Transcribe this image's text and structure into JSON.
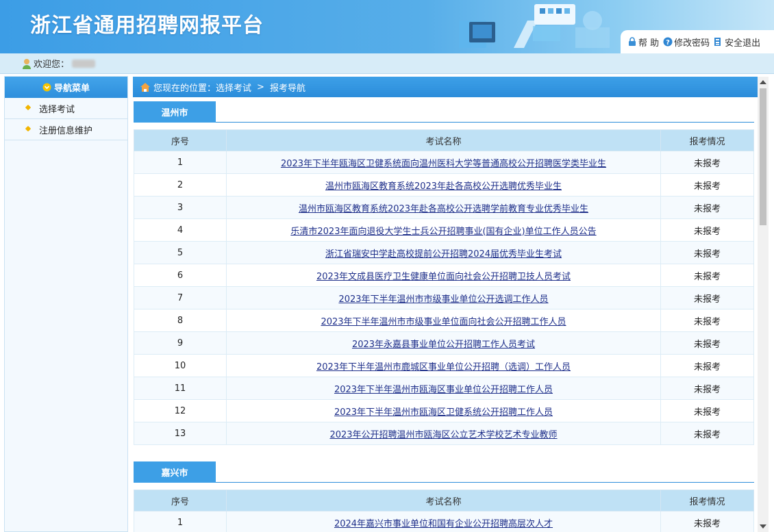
{
  "header": {
    "title": "浙江省通用招聘网报平台",
    "tools": [
      {
        "label": "帮 助",
        "icon": "lock-icon"
      },
      {
        "label": "修改密码",
        "icon": "question-icon"
      },
      {
        "label": "安全退出",
        "icon": "exit-icon"
      }
    ]
  },
  "welcome": {
    "label": "欢迎您："
  },
  "sidebar": {
    "heading": "导航菜单",
    "items": [
      {
        "label": "选择考试"
      },
      {
        "label": "注册信息维护"
      }
    ]
  },
  "breadcrumb": {
    "prefix": "您现在的位置：",
    "level1": "选择考试",
    "separator": ">",
    "level2": "报考导航"
  },
  "sections": [
    {
      "city": "温州市",
      "headers": {
        "no": "序号",
        "name": "考试名称",
        "status": "报考情况"
      },
      "rows": [
        {
          "no": "1",
          "name": "2023年下半年瓯海区卫健系统面向温州医科大学等普通高校公开招聘医学类毕业生",
          "status": "未报考"
        },
        {
          "no": "2",
          "name": "温州市瓯海区教育系统2023年赴各高校公开选聘优秀毕业生",
          "status": "未报考"
        },
        {
          "no": "3",
          "name": "温州市瓯海区教育系统2023年赴各高校公开选聘学前教育专业优秀毕业生",
          "status": "未报考"
        },
        {
          "no": "4",
          "name": "乐清市2023年面向退役大学生士兵公开招聘事业(国有企业)单位工作人员公告",
          "status": "未报考"
        },
        {
          "no": "5",
          "name": "浙江省瑞安中学赴高校提前公开招聘2024届优秀毕业生考试",
          "status": "未报考"
        },
        {
          "no": "6",
          "name": "2023年文成县医疗卫生健康单位面向社会公开招聘卫技人员考试",
          "status": "未报考"
        },
        {
          "no": "7",
          "name": "2023年下半年温州市市级事业单位公开选调工作人员",
          "status": "未报考"
        },
        {
          "no": "8",
          "name": "2023年下半年温州市市级事业单位面向社会公开招聘工作人员",
          "status": "未报考"
        },
        {
          "no": "9",
          "name": "2023年永嘉县事业单位公开招聘工作人员考试",
          "status": "未报考"
        },
        {
          "no": "10",
          "name": "2023年下半年温州市鹿城区事业单位公开招聘（选调）工作人员",
          "status": "未报考"
        },
        {
          "no": "11",
          "name": "2023年下半年温州市瓯海区事业单位公开招聘工作人员",
          "status": "未报考"
        },
        {
          "no": "12",
          "name": "2023年下半年温州市瓯海区卫健系统公开招聘工作人员",
          "status": "未报考"
        },
        {
          "no": "13",
          "name": "2023年公开招聘温州市瓯海区公立艺术学校艺术专业教师",
          "status": "未报考"
        }
      ]
    },
    {
      "city": "嘉兴市",
      "headers": {
        "no": "序号",
        "name": "考试名称",
        "status": "报考情况"
      },
      "rows": [
        {
          "no": "1",
          "name": "2024年嘉兴市事业单位和国有企业公开招聘高层次人才",
          "status": "未报考"
        }
      ]
    }
  ]
}
